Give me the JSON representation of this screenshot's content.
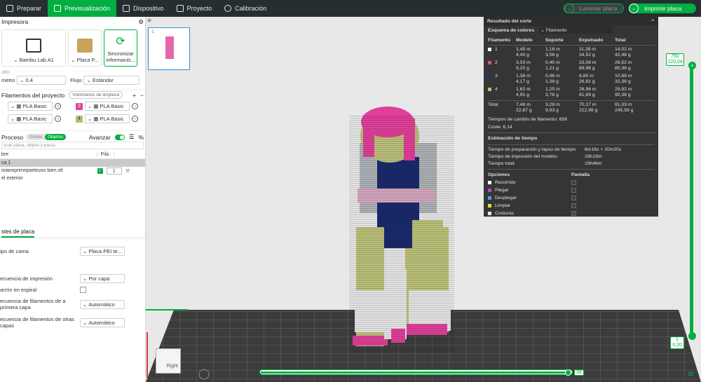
{
  "tabs": [
    {
      "label": "Preparar",
      "icon": "prepare-icon"
    },
    {
      "label": "Previsualización",
      "icon": "preview-icon"
    },
    {
      "label": "Dispositivo",
      "icon": "device-icon"
    },
    {
      "label": "Proyecto",
      "icon": "project-icon"
    },
    {
      "label": "Calibración",
      "icon": "calibration-icon"
    }
  ],
  "actions": {
    "laminar": "Laminar placa",
    "imprimir": "Imprimir placa"
  },
  "printer": {
    "title": "Impresora",
    "printer_name": "Bambu Lab A1",
    "plate_name": "Placa P...",
    "sync_label": "Sincronizar información",
    "sync_label_l1": "Sincronizar",
    "sync_label_l2": "informació...",
    "nozzle_prefix": "alto",
    "diam_label": "metro",
    "diam_value": "0.4",
    "flow_label": "Flujo",
    "flow_value": "Estándar"
  },
  "filaments": {
    "title": "Filamentos del proyecto",
    "flush_btn": "Volúmenes de limpieza",
    "items": [
      {
        "num": "1",
        "color": "#ffffff",
        "name": "PLA Basic"
      },
      {
        "num": "2",
        "color": "#e0409a",
        "name": "PLA Basic"
      },
      {
        "num": "3",
        "color": "#1a2a6c",
        "name": "PLA Basic"
      },
      {
        "num": "4",
        "color": "#b8bf74",
        "name": "PLA Basic"
      }
    ]
  },
  "process": {
    "title": "Proceso",
    "global": "Global",
    "objects": "Objetos",
    "advance": "Avanzar",
    "search_placeholder": "scar placa, objeto y pieza.",
    "col_name": "bre",
    "col_fila": "Fila.",
    "plate_row": "ca 1",
    "object_name": "iniaimprimirparteuno bien.stl",
    "object_count": "1",
    "object_sub": "el exterior"
  },
  "plate_settings": {
    "title": "stes de placa",
    "rows": [
      {
        "label": "ipo de cama",
        "value": "Placa PEI te..."
      },
      {
        "label": "ecuencia de impresión",
        "value": "Por capa"
      },
      {
        "label": "arrón en espiral",
        "value": ""
      },
      {
        "label": "ecuencia de filamentos de a primera capa",
        "value": "Automático"
      },
      {
        "label": "ecuencia de filamentos de otras capas",
        "value": "Automático"
      }
    ]
  },
  "viewport": {
    "plate_number": "1",
    "cube_label": "Right"
  },
  "result": {
    "title": "Resultado del corte",
    "scheme_label": "Esquema de colores",
    "scheme_value": "Filamento",
    "headers": [
      "Filamento",
      "Modelo",
      "Soporte",
      "Expulsado",
      "Total"
    ],
    "rows": [
      {
        "id": "1",
        "color": "#ffffff",
        "modelo": [
          "1,45 m",
          "4,40 g"
        ],
        "soporte": [
          "1,18 m",
          "3,56 g"
        ],
        "expulsado": [
          "11,39 m",
          "34,52 g"
        ],
        "total": [
          "14,02 m",
          "42,48 g"
        ]
      },
      {
        "id": "2",
        "color": "#e0409a",
        "modelo": [
          "3,03 m",
          "9,20 g"
        ],
        "soporte": [
          "0,40 m",
          "1,21 g"
        ],
        "expulsado": [
          "23,08 m",
          "69,96 g"
        ],
        "total": [
          "26,52 m",
          "80,36 g"
        ]
      },
      {
        "id": "3",
        "color": "#1a2a6c",
        "modelo": [
          "1,38 m",
          "4,17 g"
        ],
        "soporte": [
          "0,46 m",
          "1,38 g"
        ],
        "expulsado": [
          "8,85 m",
          "26,81 g"
        ],
        "total": [
          "10,68 m",
          "32,36 g"
        ]
      },
      {
        "id": "4",
        "color": "#b8bf74",
        "modelo": [
          "1,62 m",
          "4,91 g"
        ],
        "soporte": [
          "1,25 m",
          "3,78 g"
        ],
        "expulsado": [
          "26,96 m",
          "81,69 g"
        ],
        "total": [
          "29,82 m",
          "90,38 g"
        ]
      }
    ],
    "total_row": {
      "label": "Total",
      "modelo": [
        "7,48 m",
        "22,67 g"
      ],
      "soporte": [
        "3,28 m",
        "9,93 g"
      ],
      "expulsado": [
        "70,27 m",
        "212,98 g"
      ],
      "total": [
        "81,03 m",
        "245,58 g"
      ]
    },
    "changes": "Tiempos de cambio de filamento:  658",
    "cost": "Coste:  6,14",
    "time_title": "Estimación de tiempo",
    "times": [
      {
        "label": "Tiempo de preparación y lapso de tiempo:",
        "value": "6m16s + 20m20s"
      },
      {
        "label": "Tiempo de impresión del modelo:",
        "value": "19h19m"
      },
      {
        "label": "Tiempo total:",
        "value": "19h46m"
      }
    ],
    "options_label": "Opciones",
    "display_label": "Pantalla",
    "options": [
      {
        "label": "Recorrido",
        "color": "#ffffff",
        "checked": false
      },
      {
        "label": "Plegar",
        "color": "#c040c0",
        "checked": false
      },
      {
        "label": "Desplegar",
        "color": "#40a0e0",
        "checked": false
      },
      {
        "label": "Limpiar",
        "color": "#e0e040",
        "checked": false
      },
      {
        "label": "Costuras",
        "color": "#e8e8e8",
        "checked": true
      }
    ]
  },
  "layers": {
    "top_max": "750",
    "top_height": "120,04",
    "bottom_min": "1",
    "bottom_height": "0,20",
    "move_value": "39"
  }
}
